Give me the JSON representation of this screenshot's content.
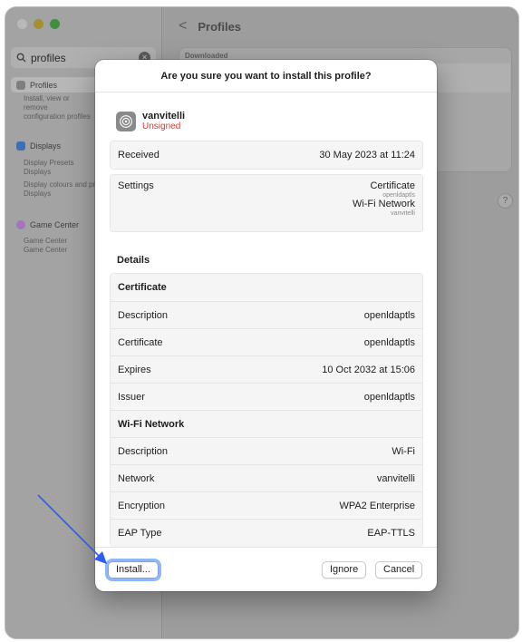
{
  "search": {
    "value": "profiles"
  },
  "sidebar": {
    "profiles": {
      "label": "Profiles",
      "desc": "Install, view or remove configuration profiles"
    },
    "displays": {
      "label": "Displays"
    },
    "display_presets": {
      "label": "Display Presets",
      "desc": "Displays"
    },
    "display_colours": {
      "label": "Display colours and profiles",
      "desc": "Displays"
    },
    "game_center": {
      "label": "Game Center"
    },
    "game_center_sub": {
      "label": "Game Center",
      "desc": "Game Center"
    }
  },
  "main": {
    "title": "Profiles",
    "back_glyph": "<",
    "list_label": "Downloaded",
    "help_glyph": "?"
  },
  "sheet": {
    "title": "Are you sure you want to install this profile?",
    "profile_name": "vanvitelli",
    "profile_status": "Unsigned",
    "received": {
      "label": "Received",
      "value": "30 May 2023 at 11:24"
    },
    "settings": {
      "label": "Settings",
      "items": [
        {
          "name": "Certificate",
          "sub": "openldaptls"
        },
        {
          "name": "Wi-Fi Network",
          "sub": "vanvitelli"
        }
      ]
    },
    "details_label": "Details",
    "certificate": {
      "heading": "Certificate",
      "rows": [
        {
          "label": "Description",
          "value": "openldaptls"
        },
        {
          "label": "Certificate",
          "value": "openldaptls"
        },
        {
          "label": "Expires",
          "value": "10 Oct 2032 at 15:06"
        },
        {
          "label": "Issuer",
          "value": "openldaptls"
        }
      ]
    },
    "wifi": {
      "heading": "Wi-Fi Network",
      "rows": [
        {
          "label": "Description",
          "value": "Wi-Fi"
        },
        {
          "label": "Network",
          "value": "vanvitelli"
        },
        {
          "label": "Encryption",
          "value": "WPA2 Enterprise"
        },
        {
          "label": "EAP Type",
          "value": "EAP-TTLS"
        }
      ]
    },
    "buttons": {
      "install": "Install...",
      "ignore": "Ignore",
      "cancel": "Cancel"
    }
  },
  "colors": {
    "accent": "#2f5bf0",
    "unsigned": "#e8312e"
  }
}
